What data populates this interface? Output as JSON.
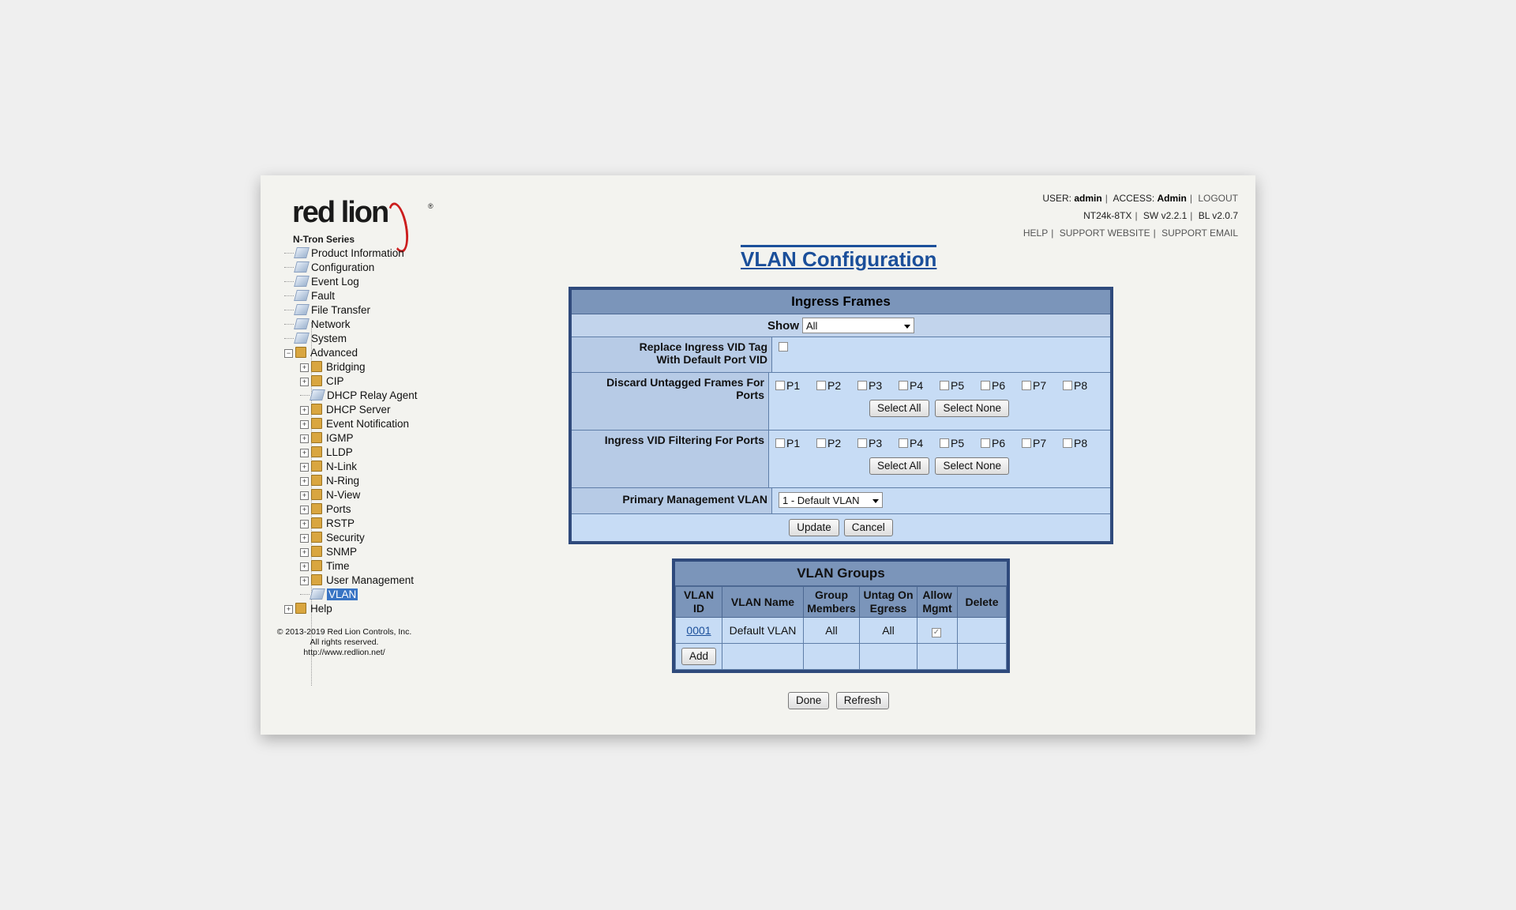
{
  "logo": {
    "brand": "red lion",
    "registered": "®",
    "series": "N-Tron Series"
  },
  "header": {
    "user_label": "USER:",
    "user": "admin",
    "access_label": "ACCESS:",
    "access": "Admin",
    "logout": "LOGOUT",
    "model": "NT24k-8TX",
    "sw": "SW v2.2.1",
    "bl": "BL v2.0.7",
    "help": "HELP",
    "support_website": "SUPPORT WEBSITE",
    "support_email": "SUPPORT EMAIL"
  },
  "tree": {
    "top": [
      "Product Information",
      "Configuration",
      "Event Log",
      "Fault",
      "File Transfer",
      "Network",
      "System"
    ],
    "advanced": "Advanced",
    "advanced_children": [
      "Bridging",
      "CIP",
      "DHCP Relay Agent",
      "DHCP Server",
      "Event Notification",
      "IGMP",
      "LLDP",
      "N-Link",
      "N-Ring",
      "N-View",
      "Ports",
      "RSTP",
      "Security",
      "SNMP",
      "Time",
      "User Management",
      "VLAN"
    ],
    "help": "Help"
  },
  "copyright": {
    "line1": "© 2013-2019 Red Lion Controls, Inc.",
    "line2": "All rights reserved.",
    "line3": "http://www.redlion.net/"
  },
  "page_title": "VLAN Configuration",
  "ingress": {
    "heading": "Ingress Frames",
    "show_label": "Show",
    "show_value": "All",
    "replace_label_1": "Replace Ingress VID Tag",
    "replace_label_2": "With Default Port VID",
    "discard_label": "Discard Untagged Frames For Ports",
    "filter_label": "Ingress VID Filtering For Ports",
    "ports": [
      "P1",
      "P2",
      "P3",
      "P4",
      "P5",
      "P6",
      "P7",
      "P8"
    ],
    "select_all": "Select All",
    "select_none": "Select None",
    "mgmt_label": "Primary Management VLAN",
    "mgmt_value": "1 - Default VLAN",
    "update": "Update",
    "cancel": "Cancel"
  },
  "groups": {
    "heading": "VLAN Groups",
    "columns": [
      "VLAN ID",
      "VLAN Name",
      "Group Members",
      "Untag On Egress",
      "Allow Mgmt",
      "Delete"
    ],
    "row": {
      "id": "0001",
      "name": "Default VLAN",
      "members": "All",
      "untag": "All"
    },
    "add": "Add"
  },
  "footer": {
    "done": "Done",
    "refresh": "Refresh"
  }
}
